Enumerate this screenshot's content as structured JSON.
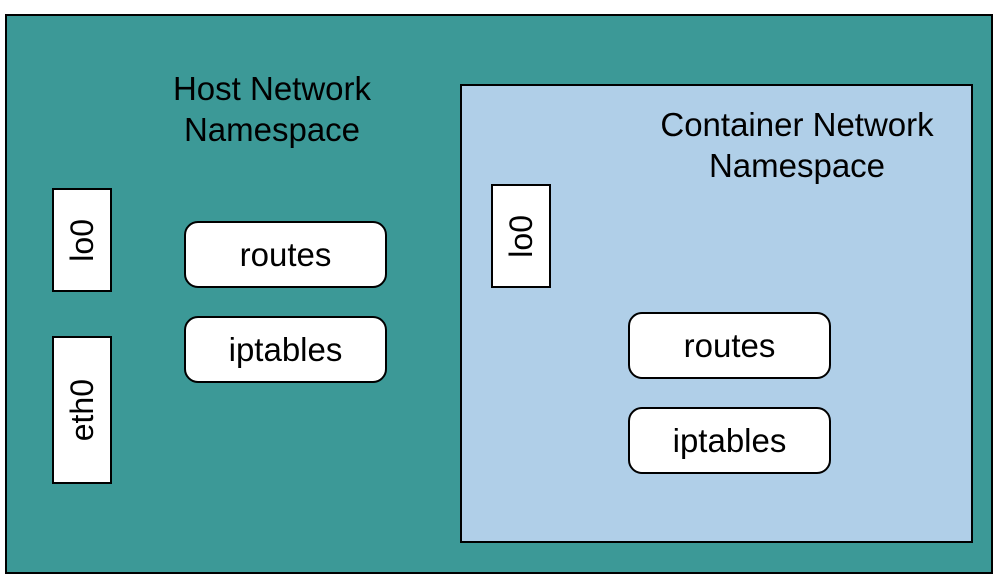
{
  "host": {
    "title": "Host Network Namespace",
    "interfaces": {
      "lo": "lo0",
      "eth0": "eth0"
    },
    "routes_label": "routes",
    "iptables_label": "iptables"
  },
  "container": {
    "title": "Container Network Namespace",
    "interfaces": {
      "lo": "lo0"
    },
    "routes_label": "routes",
    "iptables_label": "iptables"
  }
}
